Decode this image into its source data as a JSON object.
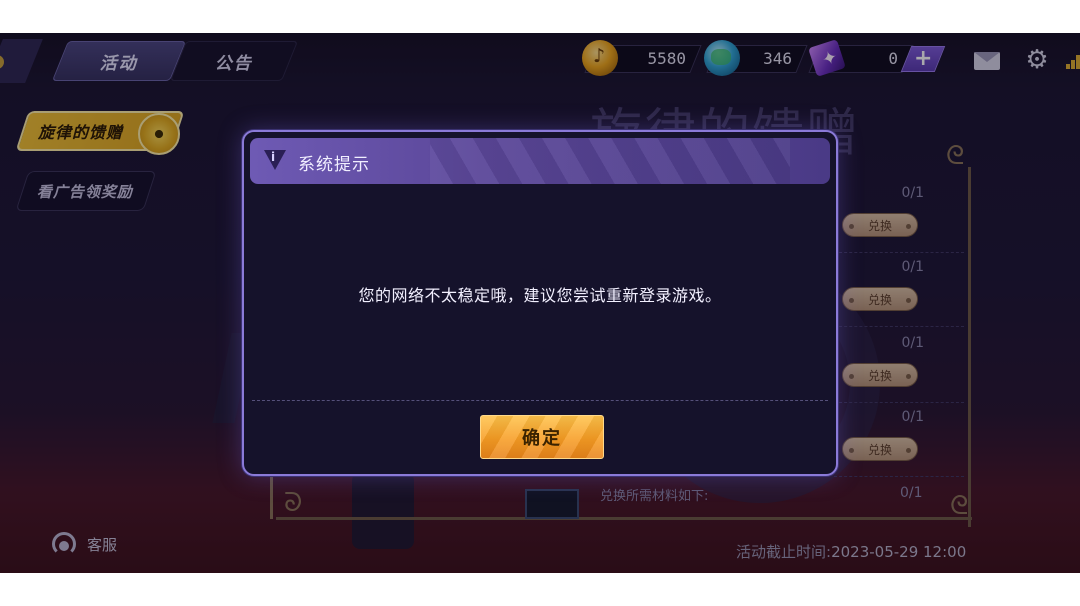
{
  "tabs": [
    {
      "label": "活动",
      "active": true
    },
    {
      "label": "公告",
      "active": false
    }
  ],
  "currencies": [
    {
      "icon": "music-coin-icon",
      "value": "5580"
    },
    {
      "icon": "globe-gem-icon",
      "value": "346"
    },
    {
      "icon": "card-ticket-icon",
      "value": "0"
    }
  ],
  "header_icons": [
    "plus-icon",
    "mail-icon",
    "gear-icon",
    "signal-icon"
  ],
  "side_menu": [
    {
      "label": "旋律的馈赠",
      "active": true
    },
    {
      "label": "看广告领奖励",
      "active": false
    }
  ],
  "event": {
    "title": "旋律的馈赠",
    "tasks": [
      {
        "progress": "0/1",
        "button": "兑换"
      },
      {
        "progress": "0/1",
        "button": "兑换"
      },
      {
        "progress": "0/1",
        "button": "兑换"
      },
      {
        "progress": "0/1",
        "button": "兑换"
      }
    ],
    "materials_label": "兑换所需材料如下:",
    "materials_progress": "0/1",
    "deadline_label": "活动截止时间:",
    "deadline_value": "2023-05-29 12:00"
  },
  "customer_service": "客服",
  "dialog": {
    "title": "系统提示",
    "message": "您的网络不太稳定哦，建议您尝试重新登录游戏。",
    "confirm": "确定"
  },
  "colors": {
    "accent_gold": "#f2c234",
    "dialog_border": "#8b7ad8",
    "confirm_orange": "#f79d24"
  }
}
